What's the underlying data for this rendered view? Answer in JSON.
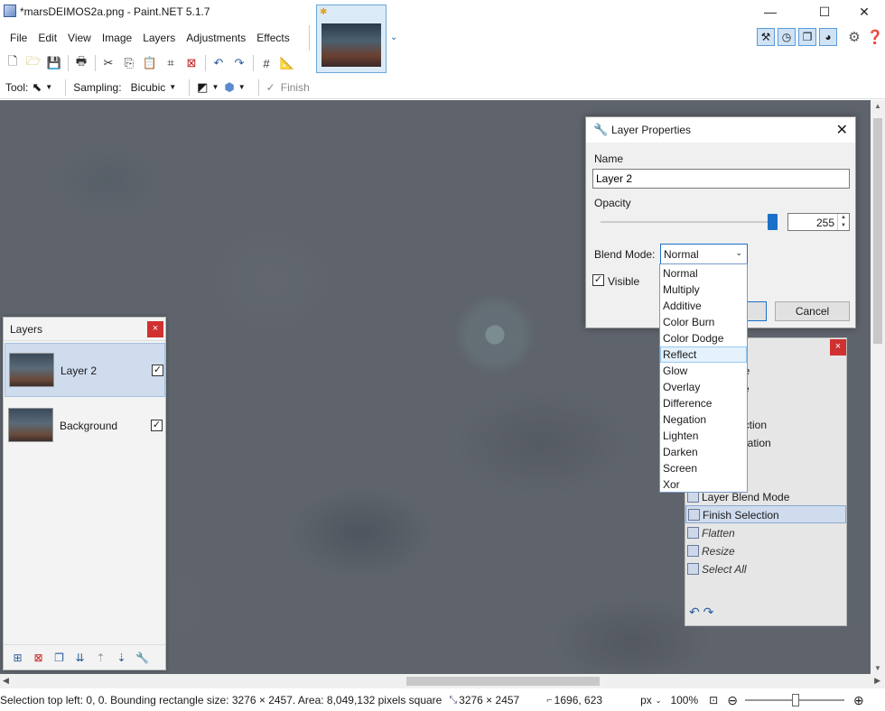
{
  "window": {
    "title": "*marsDEIMOS2a.png - Paint.NET 5.1.7"
  },
  "menu": [
    "File",
    "Edit",
    "View",
    "Image",
    "Layers",
    "Adjustments",
    "Effects"
  ],
  "tool_options": {
    "tool_label": "Tool:",
    "sampling_label": "Sampling:",
    "sampling_value": "Bicubic",
    "finish_label": "Finish"
  },
  "layers_panel": {
    "title": "Layers",
    "layers": [
      {
        "name": "Layer 2",
        "visible": true,
        "selected": true
      },
      {
        "name": "Background",
        "visible": true,
        "selected": false
      }
    ]
  },
  "history_panel": {
    "partial_items": [
      "ge",
      "ze",
      "ection",
      "uration",
      "r"
    ],
    "items": [
      {
        "label": "Layer Blend Mode",
        "state": "done"
      },
      {
        "label": "Finish Selection",
        "state": "current"
      },
      {
        "label": "Flatten",
        "state": "redo"
      },
      {
        "label": "Resize",
        "state": "redo"
      },
      {
        "label": "Select All",
        "state": "redo"
      }
    ]
  },
  "dialog": {
    "title": "Layer Properties",
    "name_label": "Name",
    "name_value": "Layer 2",
    "opacity_label": "Opacity",
    "opacity_value": "255",
    "opacity_fraction": 1.0,
    "blend_label": "Blend Mode:",
    "blend_value": "Normal",
    "visible_label": "Visible",
    "visible_checked": true,
    "cancel_label": "Cancel"
  },
  "blend_modes": {
    "options": [
      "Normal",
      "Multiply",
      "Additive",
      "Color Burn",
      "Color Dodge",
      "Reflect",
      "Glow",
      "Overlay",
      "Difference",
      "Negation",
      "Lighten",
      "Darken",
      "Screen",
      "Xor"
    ],
    "highlighted": "Reflect"
  },
  "status": {
    "selection_info": "Selection top left: 0, 0. Bounding rectangle size: 3276 × 2457. Area: 8,049,132 pixels square",
    "image_size": "3276 × 2457",
    "cursor_pos": "1696, 623",
    "unit": "px",
    "zoom": "100%"
  },
  "colors": {
    "accent": "#1a70c8",
    "selection": "#cfdcee",
    "close_red": "#d03030"
  }
}
